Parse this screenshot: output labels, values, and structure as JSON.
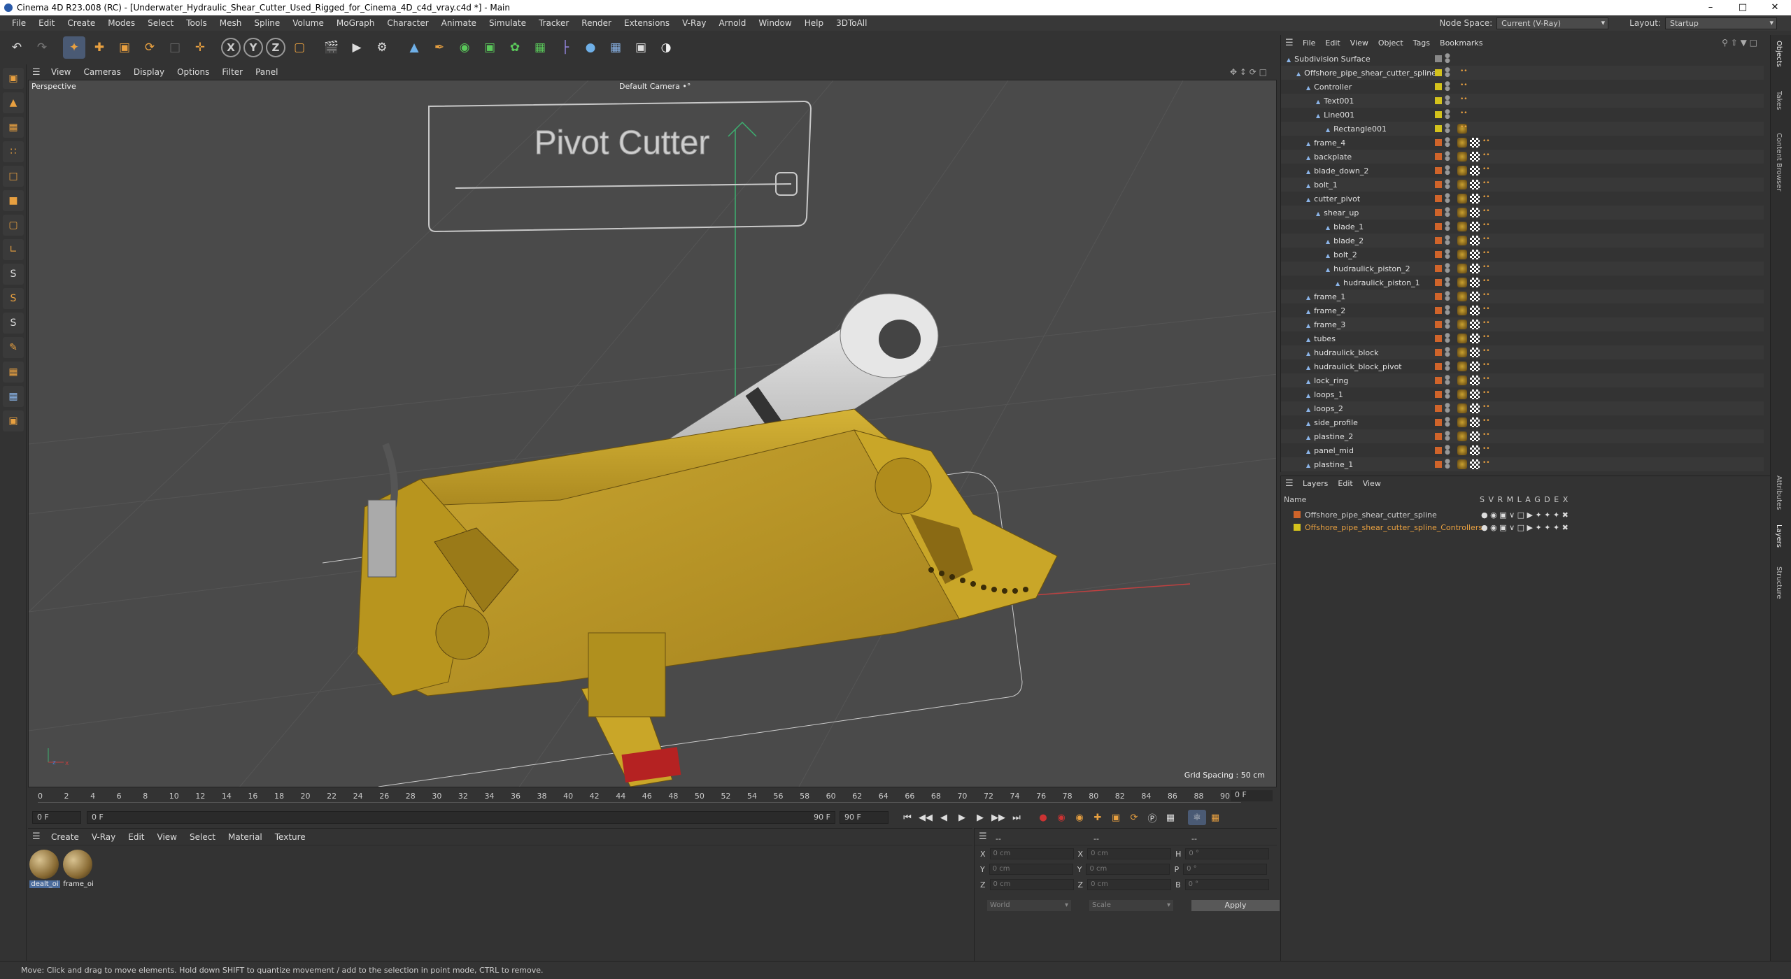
{
  "window": {
    "title": "Cinema 4D R23.008 (RC) - [Underwater_Hydraulic_Shear_Cutter_Used_Rigged_for_Cinema_4D_c4d_vray.c4d *] - Main",
    "min": "–",
    "max": "□",
    "close": "✕"
  },
  "menu": {
    "items": [
      "File",
      "Edit",
      "Create",
      "Modes",
      "Select",
      "Tools",
      "Mesh",
      "Spline",
      "Volume",
      "MoGraph",
      "Character",
      "Animate",
      "Simulate",
      "Tracker",
      "Render",
      "Extensions",
      "V-Ray",
      "Arnold",
      "Window",
      "Help",
      "3DToAll"
    ],
    "node_space_label": "Node Space:",
    "node_space_value": "Current (V-Ray)",
    "layout_label": "Layout:",
    "layout_value": "Startup"
  },
  "toolbar": {
    "x": "X",
    "y": "Y",
    "z": "Z"
  },
  "viewport": {
    "menu": [
      "View",
      "Cameras",
      "Display",
      "Options",
      "Filter",
      "Panel"
    ],
    "label": "Perspective",
    "camera": "Default Camera •°",
    "grid_spacing": "Grid Spacing : 50 cm",
    "scene_text": "Pivot Cutter"
  },
  "timeline": {
    "ticks": [
      "0",
      "2",
      "4",
      "6",
      "8",
      "10",
      "12",
      "14",
      "16",
      "18",
      "20",
      "22",
      "24",
      "26",
      "28",
      "30",
      "32",
      "34",
      "36",
      "38",
      "40",
      "42",
      "44",
      "46",
      "48",
      "50",
      "52",
      "54",
      "56",
      "58",
      "60",
      "62",
      "64",
      "66",
      "68",
      "70",
      "72",
      "74",
      "76",
      "78",
      "80",
      "82",
      "84",
      "86",
      "88",
      "90"
    ],
    "current_frame": "0 F",
    "start_field": "0 F",
    "range_start": "0 F",
    "range_end": "90 F",
    "end_field": "90 F"
  },
  "materials": {
    "menu": [
      "Create",
      "V-Ray",
      "Edit",
      "View",
      "Select",
      "Material",
      "Texture"
    ],
    "items": [
      {
        "label": "dealt_oi"
      },
      {
        "label": "frame_oi"
      }
    ]
  },
  "coords": {
    "header_left": "--",
    "header_mid": "--",
    "header_right": "--",
    "rows": [
      {
        "a": "X",
        "av": "0 cm",
        "b": "X",
        "bv": "0 cm",
        "c": "H",
        "cv": "0 °"
      },
      {
        "a": "Y",
        "av": "0 cm",
        "b": "Y",
        "bv": "0 cm",
        "c": "P",
        "cv": "0 °"
      },
      {
        "a": "Z",
        "av": "0 cm",
        "b": "Z",
        "bv": "0 cm",
        "c": "B",
        "cv": "0 °"
      }
    ],
    "mode": "World",
    "scale": "Scale",
    "apply": "Apply"
  },
  "object_manager": {
    "menu": [
      "File",
      "Edit",
      "View",
      "Object",
      "Tags",
      "Bookmarks"
    ],
    "objects": [
      {
        "name": "Subdivision Surface",
        "depth": 0,
        "color": "#888888"
      },
      {
        "name": "Offshore_pipe_shear_cutter_spline",
        "depth": 1,
        "color": "#d4c21c"
      },
      {
        "name": "Controller",
        "depth": 2,
        "color": "#d4c21c"
      },
      {
        "name": "Text001",
        "depth": 3,
        "color": "#d4c21c"
      },
      {
        "name": "Line001",
        "depth": 3,
        "color": "#d4c21c"
      },
      {
        "name": "Rectangle001",
        "depth": 4,
        "color": "#d4c21c"
      },
      {
        "name": "frame_4",
        "depth": 2,
        "color": "#d0642a"
      },
      {
        "name": "backplate",
        "depth": 2,
        "color": "#d0642a"
      },
      {
        "name": "blade_down_2",
        "depth": 2,
        "color": "#d0642a"
      },
      {
        "name": "bolt_1",
        "depth": 2,
        "color": "#d0642a"
      },
      {
        "name": "cutter_pivot",
        "depth": 2,
        "color": "#d0642a"
      },
      {
        "name": "shear_up",
        "depth": 3,
        "color": "#d0642a"
      },
      {
        "name": "blade_1",
        "depth": 4,
        "color": "#d0642a"
      },
      {
        "name": "blade_2",
        "depth": 4,
        "color": "#d0642a"
      },
      {
        "name": "bolt_2",
        "depth": 4,
        "color": "#d0642a"
      },
      {
        "name": "hudraulick_piston_2",
        "depth": 4,
        "color": "#d0642a"
      },
      {
        "name": "hudraulick_piston_1",
        "depth": 5,
        "color": "#d0642a"
      },
      {
        "name": "frame_1",
        "depth": 2,
        "color": "#d0642a"
      },
      {
        "name": "frame_2",
        "depth": 2,
        "color": "#d0642a"
      },
      {
        "name": "frame_3",
        "depth": 2,
        "color": "#d0642a"
      },
      {
        "name": "tubes",
        "depth": 2,
        "color": "#d0642a"
      },
      {
        "name": "hudraulick_block",
        "depth": 2,
        "color": "#d0642a"
      },
      {
        "name": "hudraulick_block_pivot",
        "depth": 2,
        "color": "#d0642a"
      },
      {
        "name": "lock_ring",
        "depth": 2,
        "color": "#d0642a"
      },
      {
        "name": "loops_1",
        "depth": 2,
        "color": "#d0642a"
      },
      {
        "name": "loops_2",
        "depth": 2,
        "color": "#d0642a"
      },
      {
        "name": "side_profile",
        "depth": 2,
        "color": "#d0642a"
      },
      {
        "name": "plastine_2",
        "depth": 2,
        "color": "#d0642a"
      },
      {
        "name": "panel_mid",
        "depth": 2,
        "color": "#d0642a"
      },
      {
        "name": "plastine_1",
        "depth": 2,
        "color": "#d0642a"
      }
    ]
  },
  "layer_manager": {
    "menu": [
      "Layers",
      "Edit",
      "View"
    ],
    "columns": {
      "name": "Name",
      "flags": "S  V  R  M  L  A  G  D  E  X"
    },
    "layers": [
      {
        "name": "Offshore_pipe_shear_cutter_spline",
        "color": "#d0642a",
        "text_color": "#e0e0e0"
      },
      {
        "name": "Offshore_pipe_shear_cutter_spline_Controllers",
        "color": "#d4c21c",
        "text_color": "#e8a040"
      }
    ]
  },
  "side_tabs": [
    "Objects",
    "Takes",
    "Content Browser",
    "Attributes",
    "Layers",
    "Structure"
  ],
  "status": "Move: Click and drag to move elements. Hold down SHIFT to quantize movement / add to the selection in point mode, CTRL to remove."
}
